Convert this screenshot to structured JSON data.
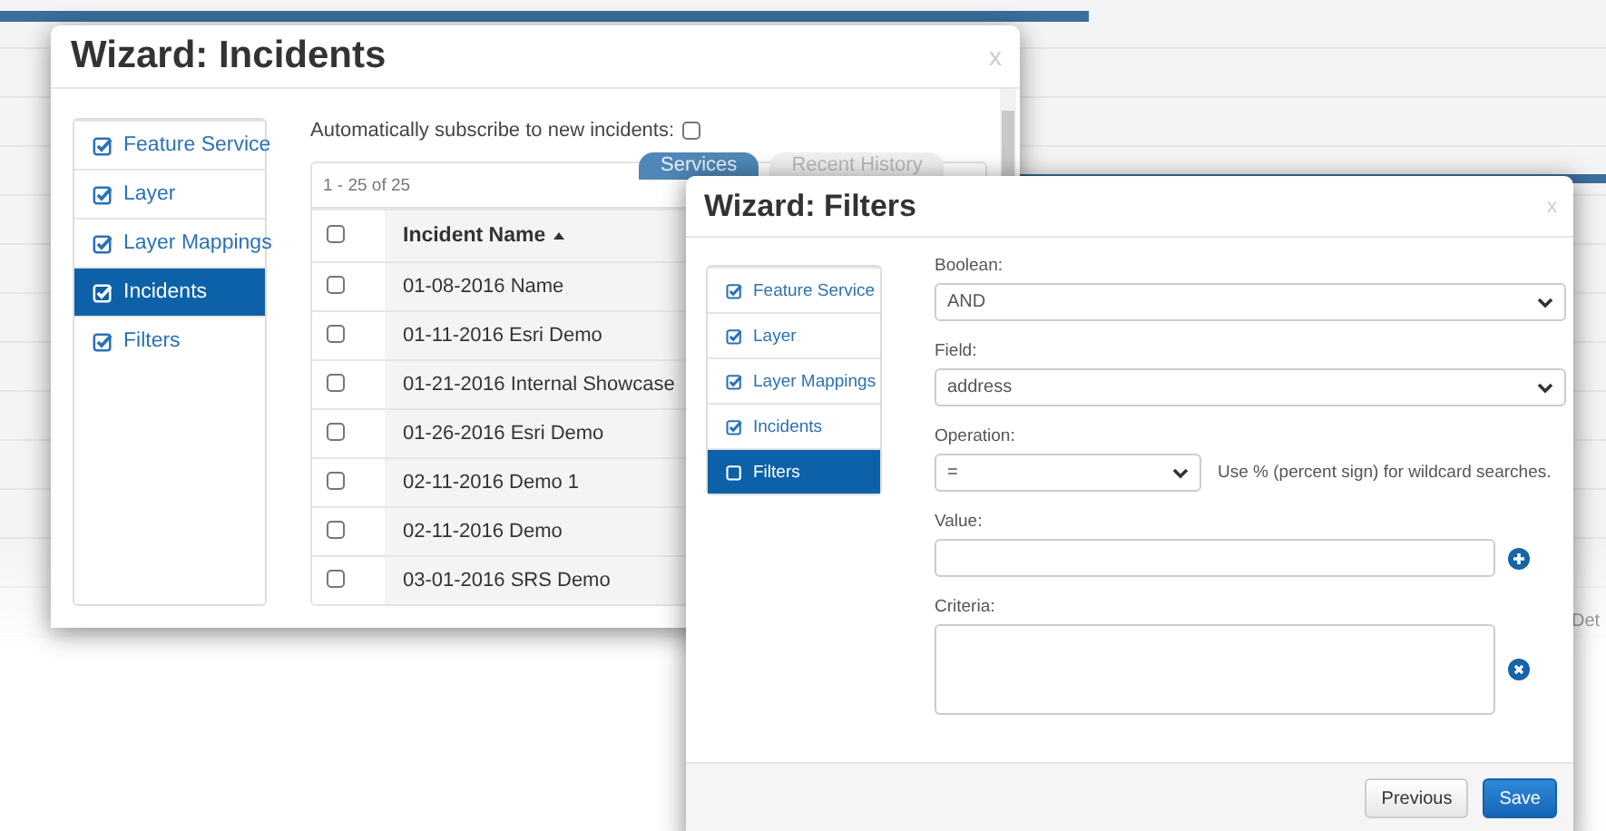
{
  "background": {
    "tabs": [
      {
        "label": "Services",
        "selected": true
      },
      {
        "label": "Recent History",
        "selected": false
      }
    ],
    "cut_text": "Det"
  },
  "incidents_dialog": {
    "title": "Wizard: Incidents",
    "close": "x",
    "steps": [
      {
        "label": "Feature Service",
        "checked": true,
        "selected": false
      },
      {
        "label": "Layer",
        "checked": true,
        "selected": false
      },
      {
        "label": "Layer Mappings",
        "checked": true,
        "selected": false
      },
      {
        "label": "Incidents",
        "checked": true,
        "selected": true
      },
      {
        "label": "Filters",
        "checked": true,
        "selected": false
      }
    ],
    "subscribe": {
      "label": "Automatically subscribe to new incidents:",
      "checked": false
    },
    "table": {
      "summary": "1 - 25 of 25",
      "select_all": false,
      "columns": [
        {
          "label": "Incident Name"
        }
      ],
      "rows": [
        {
          "name": "01-08-2016 Name",
          "checked": false
        },
        {
          "name": "01-11-2016 Esri Demo",
          "checked": false
        },
        {
          "name": "01-21-2016 Internal Showcase",
          "checked": false
        },
        {
          "name": "01-26-2016 Esri Demo",
          "checked": false
        },
        {
          "name": "02-11-2016 Demo 1",
          "checked": false
        },
        {
          "name": "02-11-2016 Demo",
          "checked": false
        },
        {
          "name": "03-01-2016 SRS Demo",
          "checked": false
        }
      ]
    }
  },
  "filters_dialog": {
    "title": "Wizard: Filters",
    "close": "x",
    "steps": [
      {
        "label": "Feature Service",
        "checked": true,
        "selected": false
      },
      {
        "label": "Layer",
        "checked": true,
        "selected": false
      },
      {
        "label": "Layer Mappings",
        "checked": true,
        "selected": false
      },
      {
        "label": "Incidents",
        "checked": true,
        "selected": false
      },
      {
        "label": "Filters",
        "checked": false,
        "selected": true
      }
    ],
    "fields": [
      {
        "kind": "select",
        "label": "Boolean:",
        "value": "AND"
      },
      {
        "kind": "select",
        "label": "Field:",
        "value": "address"
      },
      {
        "kind": "select",
        "label": "Operation:",
        "value": "=",
        "hint": "Use % (percent sign) for wildcard searches."
      },
      {
        "kind": "input",
        "label": "Value:"
      },
      {
        "kind": "textarea",
        "label": "Criteria:"
      }
    ],
    "buttons": [
      {
        "label": "Previous",
        "kind": "default"
      },
      {
        "label": "Save",
        "kind": "primary"
      }
    ]
  }
}
